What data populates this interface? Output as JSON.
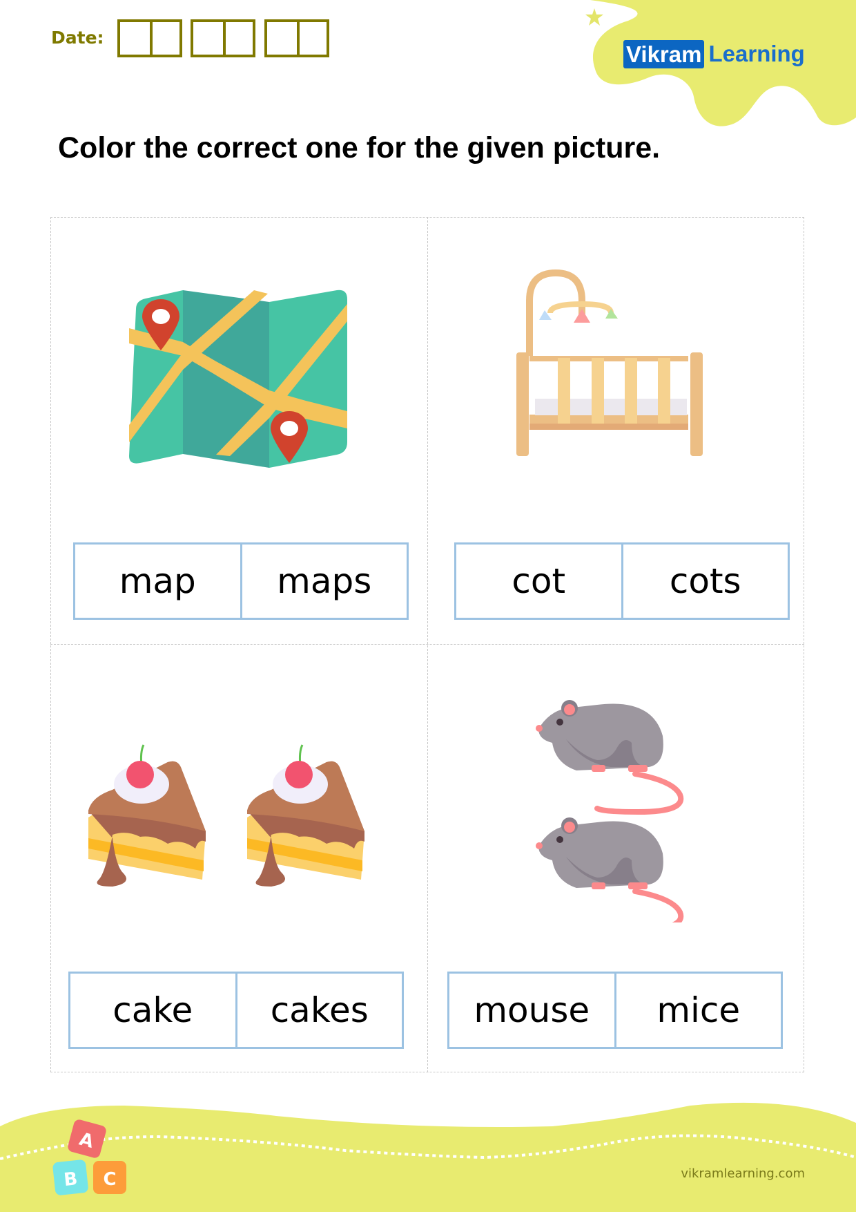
{
  "header": {
    "date_label": "Date:",
    "date_groups": 3,
    "logo": {
      "part1": "Vikram",
      "part2": "Learning"
    }
  },
  "title": "Color the correct one for the given picture.",
  "items": [
    {
      "picture": "map-icon",
      "options": [
        "map",
        "maps"
      ]
    },
    {
      "picture": "cot-icon",
      "options": [
        "cot",
        "cots"
      ]
    },
    {
      "picture": "two-cakes-icon",
      "options": [
        "cake",
        "cakes"
      ]
    },
    {
      "picture": "two-mice-icon",
      "options": [
        "mouse",
        "mice"
      ]
    }
  ],
  "footer": {
    "blocks": [
      "A",
      "B",
      "C"
    ],
    "url": "vikramlearning.com"
  },
  "colors": {
    "accent_olive": "#807900",
    "brand_blue": "#0c66c2",
    "blob_yellow": "#e8eb70",
    "box_border": "#9cc2e2"
  }
}
